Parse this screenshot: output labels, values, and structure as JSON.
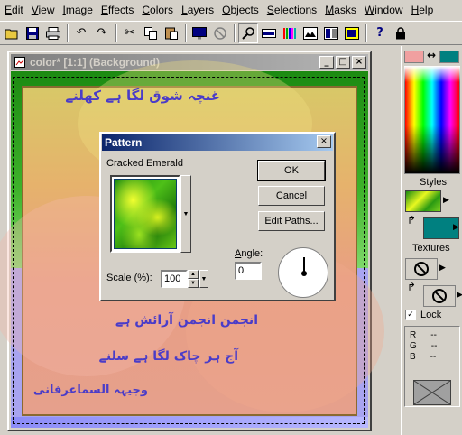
{
  "menubar": {
    "items": [
      {
        "label": "Edit",
        "u": "E",
        "rest": "dit"
      },
      {
        "label": "View",
        "u": "V",
        "rest": "iew"
      },
      {
        "label": "Image",
        "u": "I",
        "rest": "mage"
      },
      {
        "label": "Effects",
        "u": "E",
        "rest": "ffects"
      },
      {
        "label": "Colors",
        "u": "C",
        "rest": "olors"
      },
      {
        "label": "Layers",
        "u": "L",
        "rest": "ayers"
      },
      {
        "label": "Objects",
        "u": "O",
        "rest": "bjects"
      },
      {
        "label": "Selections",
        "u": "S",
        "rest": "elections"
      },
      {
        "label": "Masks",
        "u": "M",
        "rest": "asks"
      },
      {
        "label": "Window",
        "u": "W",
        "rest": "indow"
      },
      {
        "label": "Help",
        "u": "H",
        "rest": "elp"
      }
    ]
  },
  "toolbar": {
    "icons": [
      "open-icon",
      "save-icon",
      "print-icon",
      "undo-icon",
      "redo-icon",
      "cut-icon",
      "copy-icon",
      "paste-icon",
      "screen-icon",
      "no-icon",
      "zoom-icon",
      "ruler-icon",
      "histogram-icon",
      "browser-icon",
      "layers-palette-icon",
      "overview-icon",
      "help-icon",
      "lock-icon"
    ]
  },
  "document": {
    "title": "color* [1:1] (Background)",
    "minimize": "_",
    "maximize": "□",
    "close": "×"
  },
  "canvas_text": {
    "line1": "غنچہ شوق لگا ہے کھلنے",
    "line2": "انجمن انجمن آرائش ہے",
    "line3": "آج ہر چاک لگا ہے سلنے",
    "signature": "وجیہہ السماعرفانی"
  },
  "dialog": {
    "title": "Pattern",
    "close": "×",
    "pattern_name": "Cracked Emerald",
    "ok_label": "OK",
    "cancel_label": "Cancel",
    "edit_paths_label": "Edit Paths...",
    "scale_label_u": "S",
    "scale_label_rest": "cale (%):",
    "scale_value": "100",
    "angle_label_u": "A",
    "angle_label_rest": "ngle:",
    "angle_value": "0"
  },
  "palette": {
    "swap_arrow": "↔",
    "styles_label": "Styles",
    "textures_label": "Textures",
    "lock_label": "Lock",
    "lock_checked": "✓",
    "rgb": [
      {
        "ch": "R",
        "val": "--"
      },
      {
        "ch": "G",
        "val": "--"
      },
      {
        "ch": "B",
        "val": "--"
      }
    ]
  },
  "colors": {
    "foreground": "#f0a0a0",
    "background": "#008080",
    "dialog_title": "#0a246a",
    "urdu_text": "#4a3cc8"
  }
}
